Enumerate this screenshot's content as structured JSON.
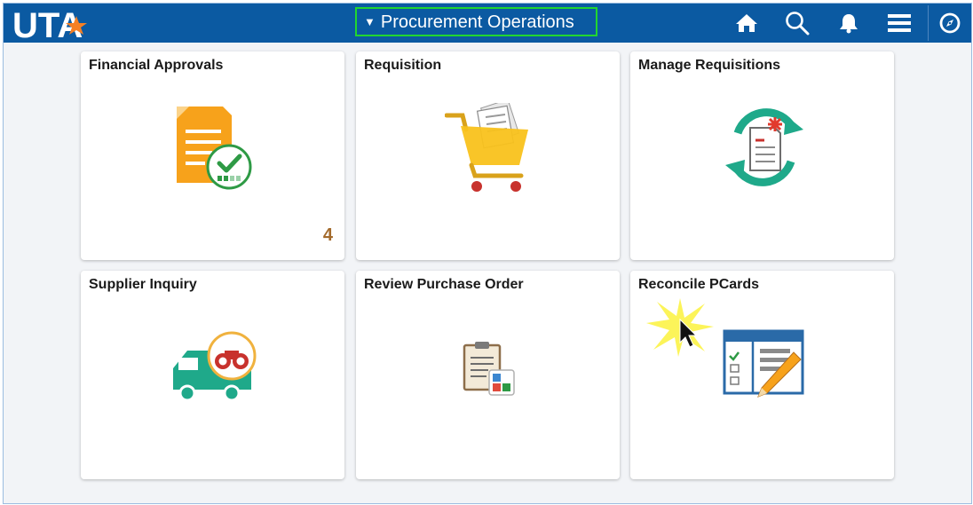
{
  "header": {
    "logo_text": "UTA",
    "title": "Procurement Operations",
    "title_caret": "▼",
    "icons": [
      "home-icon",
      "search-icon",
      "notifications-icon",
      "menu-icon",
      "navbar-compass-icon"
    ]
  },
  "tiles": [
    {
      "title": "Financial Approvals",
      "count": "4",
      "icon": "approval-document-icon"
    },
    {
      "title": "Requisition",
      "icon": "shopping-cart-icon"
    },
    {
      "title": "Manage Requisitions",
      "icon": "refresh-document-icon"
    },
    {
      "title": "Supplier Inquiry",
      "icon": "truck-binoculars-icon"
    },
    {
      "title": "Review Purchase Order",
      "icon": "clipboard-icon"
    },
    {
      "title": "Reconcile PCards",
      "icon": "form-pencil-icon"
    }
  ],
  "colors": {
    "header_bg": "#0b5aa2",
    "title_highlight": "#22d62f",
    "badge_count": "#a36a2c",
    "orange": "#f7a21b",
    "green": "#1fa98a"
  }
}
